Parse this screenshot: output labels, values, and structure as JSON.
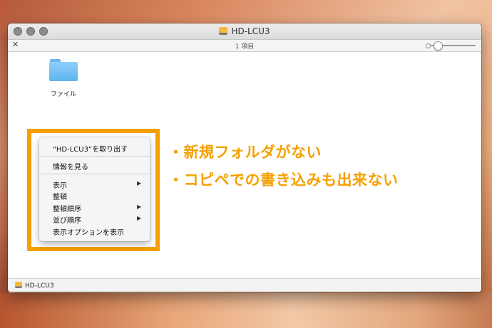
{
  "window": {
    "title": "HD-LCU3",
    "item_count": "1 項目",
    "folder_label": "ファイル",
    "path": "HD-LCU3"
  },
  "context_menu": {
    "items": [
      "“HD-LCU3”を取り出す",
      "情報を見る",
      "表示",
      "整頓",
      "整頓順序",
      "並び順序",
      "表示オプションを表示"
    ]
  },
  "annotations": [
    "・新規フォルダがない",
    "・コピペでの書き込みも出来ない"
  ],
  "colors": {
    "highlight": "#f5a000",
    "folder": "#5db4ef"
  }
}
